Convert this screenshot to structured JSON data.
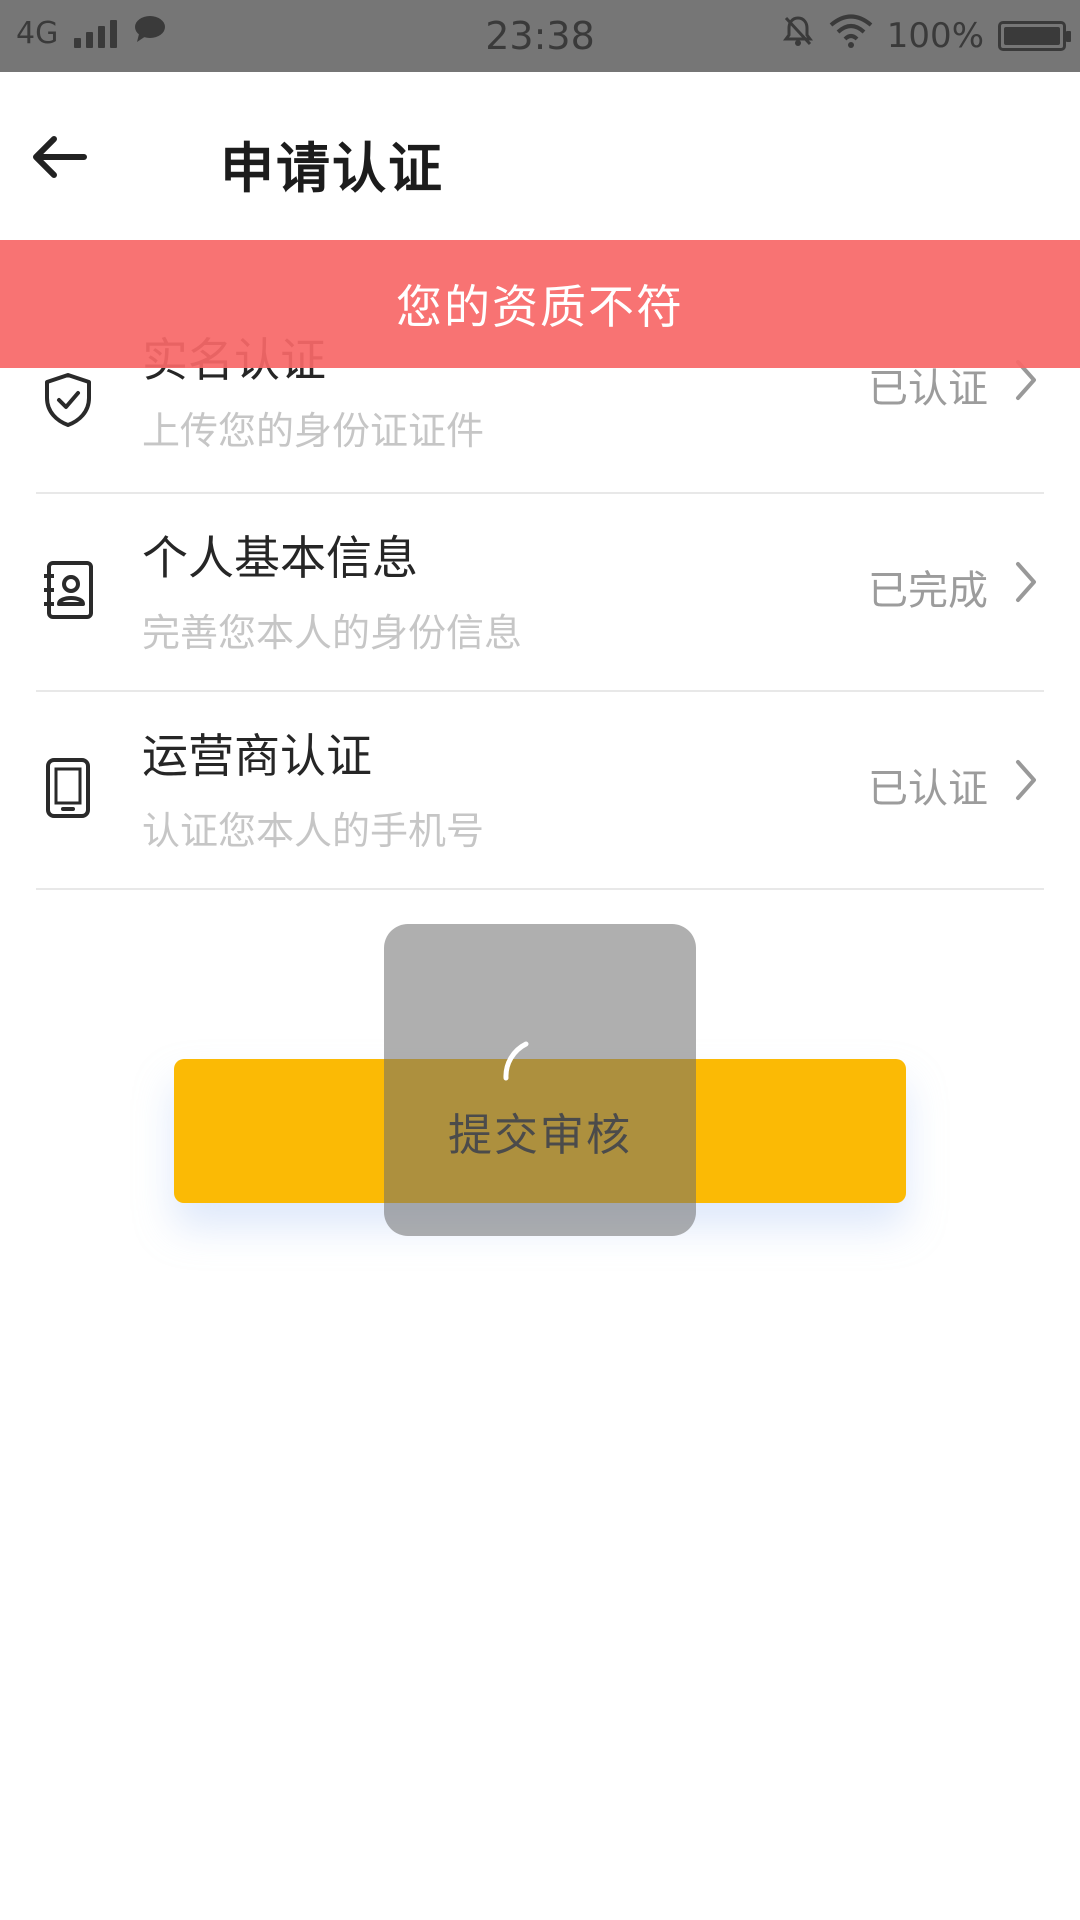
{
  "status_bar": {
    "network": "4G",
    "time": "23:38",
    "battery": "100%"
  },
  "header": {
    "title": "申请认证"
  },
  "toast": {
    "message": "您的资质不符"
  },
  "items": [
    {
      "title": "实名认证",
      "subtitle": "上传您的身份证证件",
      "status": "已认证",
      "icon": "shield-check-icon"
    },
    {
      "title": "个人基本信息",
      "subtitle": "完善您本人的身份信息",
      "status": "已完成",
      "icon": "contact-book-icon"
    },
    {
      "title": "运营商认证",
      "subtitle": "认证您本人的手机号",
      "status": "已认证",
      "icon": "mobile-phone-icon"
    }
  ],
  "submit": {
    "label": "提交审核"
  },
  "colors": {
    "accent": "#FBBA05",
    "toast_bg": "#F86868",
    "status_bar": "#767676"
  }
}
